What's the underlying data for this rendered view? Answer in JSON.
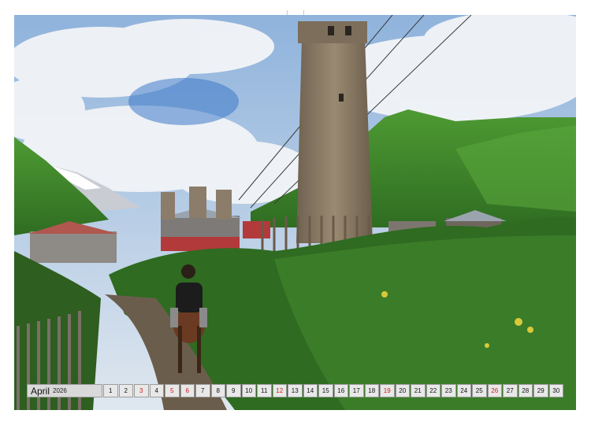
{
  "calendar": {
    "month": "April",
    "year": "2026",
    "days": [
      {
        "n": "1",
        "red": false
      },
      {
        "n": "2",
        "red": false
      },
      {
        "n": "3",
        "red": true
      },
      {
        "n": "4",
        "red": false
      },
      {
        "n": "5",
        "red": true
      },
      {
        "n": "6",
        "red": true
      },
      {
        "n": "7",
        "red": false
      },
      {
        "n": "8",
        "red": false
      },
      {
        "n": "9",
        "red": false
      },
      {
        "n": "10",
        "red": false
      },
      {
        "n": "11",
        "red": false
      },
      {
        "n": "12",
        "red": true
      },
      {
        "n": "13",
        "red": false
      },
      {
        "n": "14",
        "red": false
      },
      {
        "n": "15",
        "red": false
      },
      {
        "n": "16",
        "red": false
      },
      {
        "n": "17",
        "red": false
      },
      {
        "n": "18",
        "red": false
      },
      {
        "n": "19",
        "red": true
      },
      {
        "n": "20",
        "red": false
      },
      {
        "n": "21",
        "red": false
      },
      {
        "n": "22",
        "red": false
      },
      {
        "n": "23",
        "red": false
      },
      {
        "n": "24",
        "red": false
      },
      {
        "n": "25",
        "red": false
      },
      {
        "n": "26",
        "red": true
      },
      {
        "n": "27",
        "red": false
      },
      {
        "n": "28",
        "red": false
      },
      {
        "n": "29",
        "red": false
      },
      {
        "n": "30",
        "red": false
      }
    ]
  },
  "colors": {
    "sky": "#a9c3e3",
    "cloud": "#eef1f5",
    "mountain_green": "#3f8a2c",
    "tower_stone": "#8b7a63",
    "foliage": "#2f6b21",
    "holiday_red": "#d11a1a"
  }
}
